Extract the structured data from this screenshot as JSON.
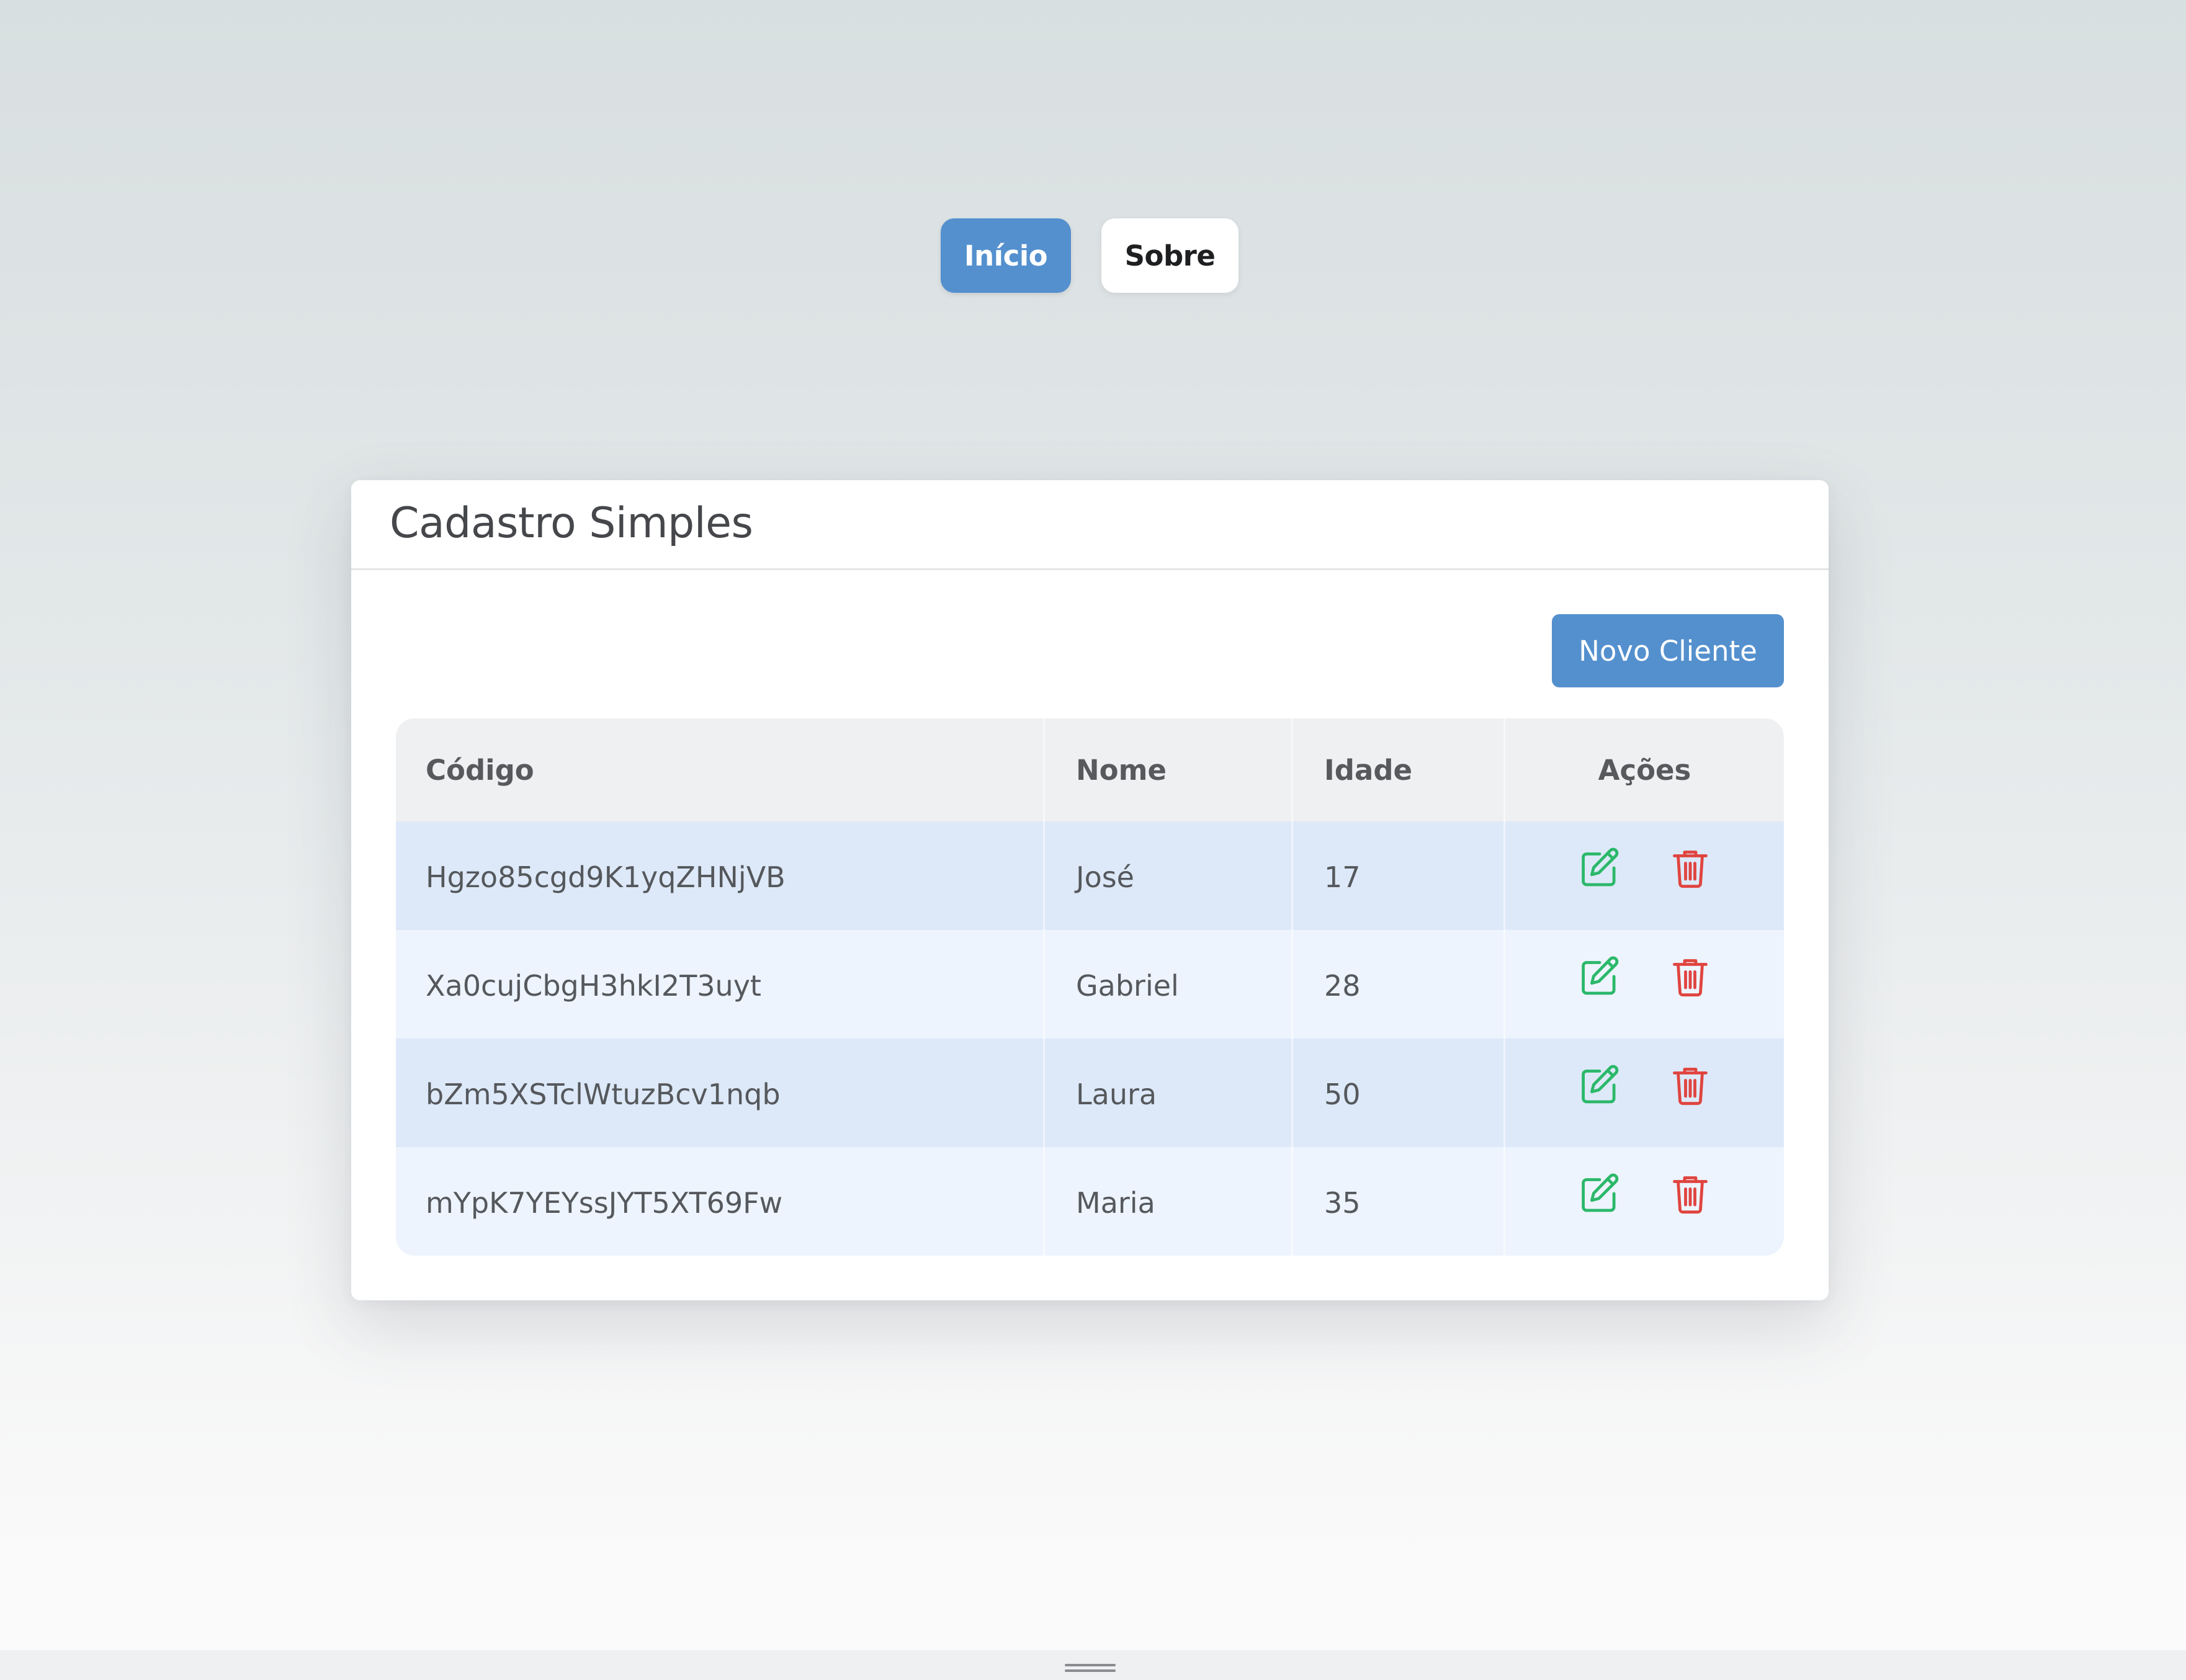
{
  "nav": {
    "items": [
      {
        "label": "Início",
        "active": true
      },
      {
        "label": "Sobre",
        "active": false
      }
    ]
  },
  "card": {
    "title": "Cadastro Simples",
    "new_button_label": "Novo Cliente"
  },
  "table": {
    "headers": {
      "code": "Código",
      "name": "Nome",
      "age": "Idade",
      "actions": "Ações"
    },
    "rows": [
      {
        "code": "Hgzo85cgd9K1yqZHNjVB",
        "name": "José",
        "age": "17"
      },
      {
        "code": "Xa0cujCbgH3hkI2T3uyt",
        "name": "Gabriel",
        "age": "28"
      },
      {
        "code": "bZm5XSTclWtuzBcv1nqb",
        "name": "Laura",
        "age": "50"
      },
      {
        "code": "mYpK7YEYssJYT5XT69Fw",
        "name": "Maria",
        "age": "35"
      }
    ],
    "row_actions": [
      "edit-icon",
      "trash-icon"
    ]
  },
  "colors": {
    "primary": "#5490ce",
    "edit": "#2bb86a",
    "delete": "#e0443f",
    "row_odd": "#dde9f8",
    "row_even": "#edf4fd",
    "header_bg": "#eff0f2"
  }
}
